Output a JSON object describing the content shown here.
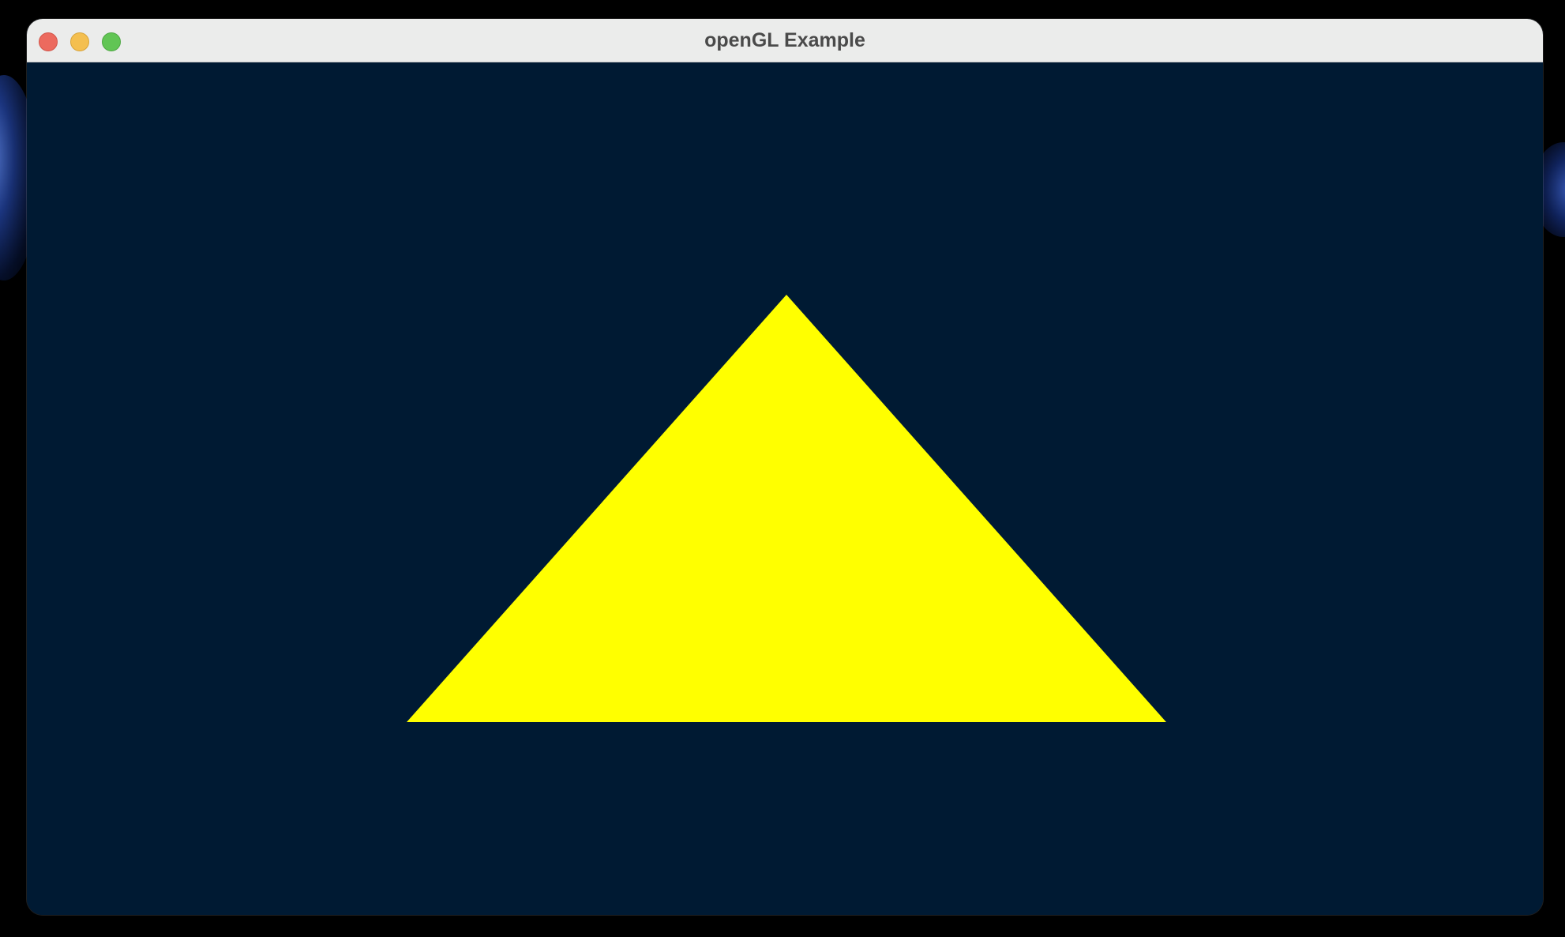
{
  "window": {
    "title": "openGL Example"
  },
  "controls": {
    "close_icon": "close-icon",
    "minimize_icon": "minimize-icon",
    "zoom_icon": "zoom-icon"
  },
  "scene": {
    "clear_color": "#001a33",
    "shape": "triangle",
    "fill_color": "#ffff00"
  },
  "colors": {
    "close": "#ec6a5e",
    "minimize": "#f4bf4f",
    "zoom": "#61c554",
    "titlebar": "#ebeceb"
  }
}
